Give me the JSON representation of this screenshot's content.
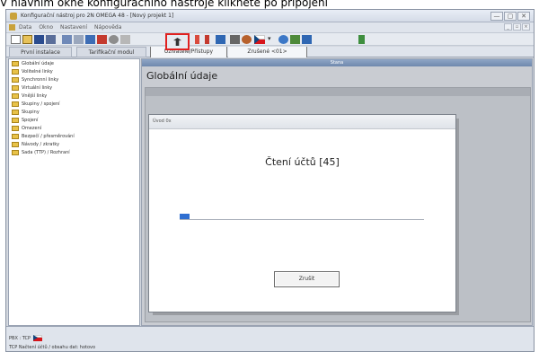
{
  "caption": "V hlavním okně konfiguračního nástroje klikněte po připojení",
  "window": {
    "title": "Konfigurační nástroj pro 2N OMEGA 48 - [Nový projekt 1]",
    "controls": [
      "—",
      "▢",
      "✕"
    ]
  },
  "menu": {
    "items": [
      "Data",
      "Okno",
      "Nastavení",
      "Nápověda"
    ],
    "mdi_controls": [
      "_",
      "▫",
      "×"
    ]
  },
  "toolbar": {
    "caret": "▾",
    "icons": [
      "new-file-icon",
      "open-folder-icon",
      "save-icon",
      "print-icon",
      "config-icon",
      "edit-icon",
      "gear-icon",
      "sync-from-pbx-icon",
      "exclamation-icon",
      "id-card-icon",
      "tree-icon",
      "user-icon",
      "czech-flag-icon",
      "help-icon",
      "key-icon"
    ],
    "highlight_color": "#e0201f"
  },
  "tabs": [
    "První instalace",
    "Tarifikační modul",
    "Uživatelé/Přístupy",
    "Zrušené <01>"
  ],
  "tree": [
    "Globální údaje",
    "Volitelné linky",
    "Synchronní linky",
    "Virtuální linky",
    "Vnější linky",
    "Skupiny / spojení",
    "Skupiny",
    "Spojení",
    "Omezení",
    "Bezpečí / přesměrování",
    "Návody / zkratky",
    "Sada (TTP) / Rozhraní"
  ],
  "main": {
    "header": "Stana",
    "page_title": "Globální údaje"
  },
  "background_window": {
    "title": "Ovlá..."
  },
  "dialog": {
    "title": "Úvod 0x",
    "message": "Čtení účtů [45]",
    "progress": 0.04,
    "cancel_label": "Zrušit"
  },
  "status": {
    "line1": "PBX : TCP",
    "line2": "TCP    Načtení účtů / obsahu dat: hotovo"
  },
  "colors": {
    "progress": "#2f6fd1",
    "highlight": "#e0201f",
    "folder": "#e8c248"
  }
}
